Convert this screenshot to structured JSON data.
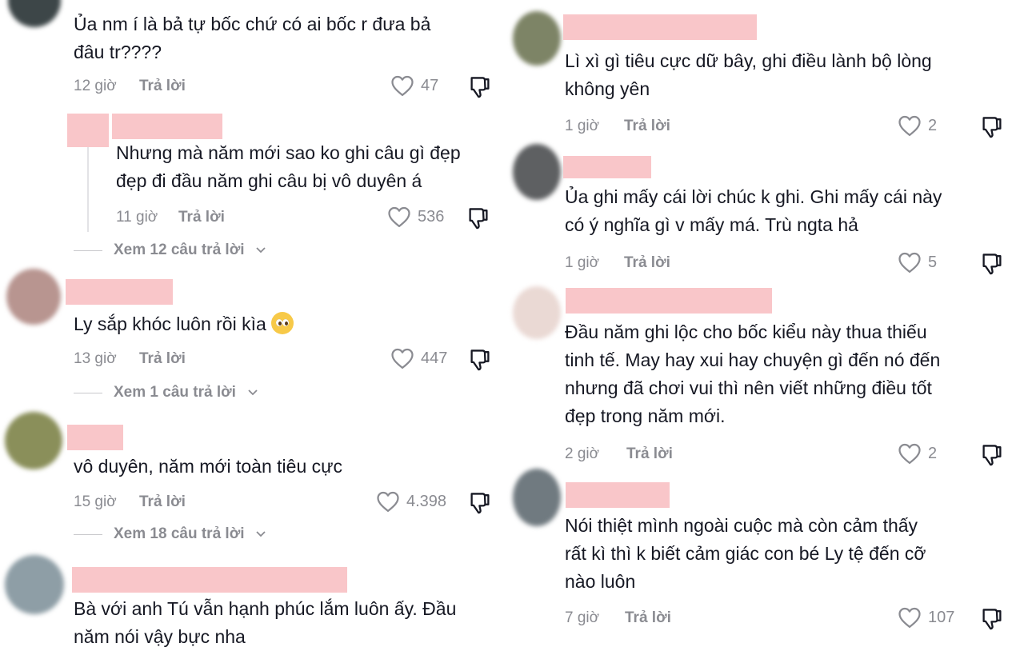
{
  "colors": {
    "name_redaction": "#f9c6c9",
    "meta": "#8a8b91",
    "text": "#161823"
  },
  "left": {
    "c1": {
      "text": "Ủa nm í là bả tự bốc chứ có ai bốc r đưa bả\nđâu tr????",
      "time": "12 giờ",
      "reply": "Trả lời",
      "likes": "47"
    },
    "c1r": {
      "text": "Nhưng mà năm mới sao ko ghi câu gì đẹp\nđẹp đi đầu năm ghi câu bị vô duyên á",
      "time": "11 giờ",
      "reply": "Trả lời",
      "likes": "536"
    },
    "c1more": "Xem 12 câu trả lời",
    "c2": {
      "text": "Ly sắp khóc luôn rồi kìa",
      "emoji": "pleading-face-emoji",
      "time": "13 giờ",
      "reply": "Trả lời",
      "likes": "447"
    },
    "c2more": "Xem 1 câu trả lời",
    "c3": {
      "text": "vô duyên, năm mới toàn tiêu cực",
      "time": "15 giờ",
      "reply": "Trả lời",
      "likes": "4.398"
    },
    "c3more": "Xem 18 câu trả lời",
    "c4": {
      "text": "Bà với anh Tú vẫn hạnh phúc lắm luôn ấy. Đầu\nnăm nói vậy bực nha"
    }
  },
  "right": {
    "c1": {
      "text": "Lì xì gì tiêu cực dữ bây, ghi điều lành bộ lòng\nkhông yên",
      "time": "1 giờ",
      "reply": "Trả lời",
      "likes": "2"
    },
    "c2": {
      "text": "Ủa ghi mấy cái lời chúc k ghi. Ghi mấy cái này\ncó ý nghĩa gì v mấy má. Trù ngta hả",
      "time": "1 giờ",
      "reply": "Trả lời",
      "likes": "5"
    },
    "c3": {
      "text": "Đầu năm ghi lộc cho bốc kiểu này thua thiếu\ntinh tế. May hay xui hay chuyện gì đến nó đến\nnhưng đã chơi vui thì nên viết những điều tốt\nđẹp trong năm mới.",
      "time": "2 giờ",
      "reply": "Trả lời",
      "likes": "2"
    },
    "c4": {
      "text": "Nói thiệt mình ngoài cuộc mà còn cảm thấy\nrất kì thì k biết cảm giác con bé Ly tệ đến cỡ\nnào luôn",
      "time": "7 giờ",
      "reply": "Trả lời",
      "likes": "107"
    }
  },
  "icons": {
    "like": "heart-outline-icon",
    "dislike": "thumbs-down-icon",
    "expand": "chevron-down-icon"
  }
}
